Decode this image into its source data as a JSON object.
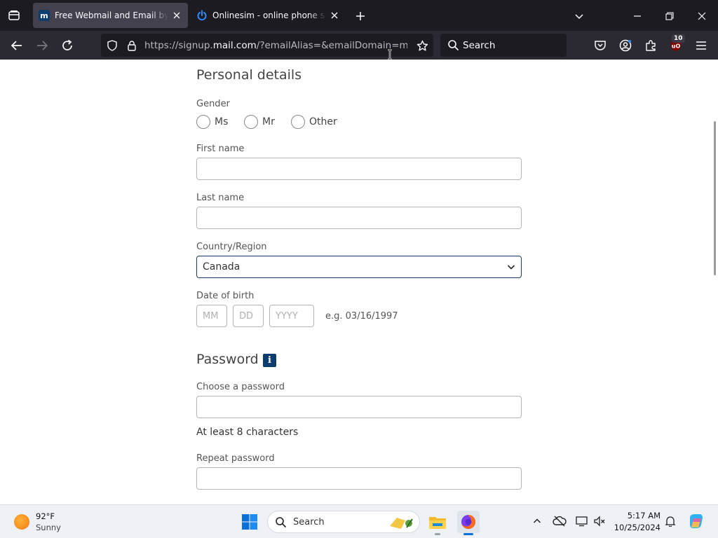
{
  "browser": {
    "tabs": [
      {
        "title": "Free Webmail and Email by mail.com",
        "favicon": "mail-com-icon",
        "active": true
      },
      {
        "title": "Onlinesim - online phone service",
        "favicon": "power-icon",
        "active": false
      }
    ],
    "url_prefix": "https://signup.",
    "url_domain": "mail.com",
    "url_suffix": "/?emailAlias=&emailDomain=mail.com",
    "search_placeholder": "Search",
    "extension_badge": "10"
  },
  "form": {
    "personal_heading": "Personal details",
    "gender_label": "Gender",
    "gender_options": [
      "Ms",
      "Mr",
      "Other"
    ],
    "first_name_label": "First name",
    "last_name_label": "Last name",
    "country_label": "Country/Region",
    "country_value": "Canada",
    "dob_label": "Date of birth",
    "dob_placeholders": {
      "month": "MM",
      "day": "DD",
      "year": "YYYY"
    },
    "dob_example": "e.g. 03/16/1997",
    "password_heading": "Password",
    "password_info_icon": "i",
    "choose_password_label": "Choose a password",
    "password_requirement": "At least 8 characters",
    "repeat_password_label": "Repeat password"
  },
  "taskbar": {
    "weather_temp": "92°F",
    "weather_condition": "Sunny",
    "search_label": "Search",
    "time": "5:17 AM",
    "date": "10/25/2024"
  },
  "colors": {
    "accent_dark_blue": "#0d3c6e",
    "firefox_chrome": "#1c1b22",
    "toolbar": "#2b2a33"
  }
}
